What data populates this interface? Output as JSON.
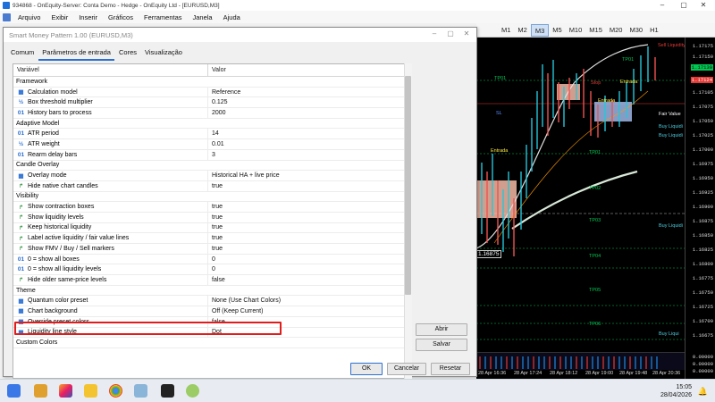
{
  "window": {
    "title": "934868 - OnEquity-Server: Conta Demo - Hedge - OnEquity Ltd - [EURUSD,M3]",
    "controls": [
      "–",
      "▢",
      "✕"
    ]
  },
  "menu": [
    "Arquivo",
    "Exibir",
    "Inserir",
    "Gráficos",
    "Ferramentas",
    "Janela",
    "Ajuda"
  ],
  "timeframes": [
    "M1",
    "M2",
    "M3",
    "M5",
    "M10",
    "M15",
    "M20",
    "M30",
    "H1"
  ],
  "active_timeframe": "M3",
  "chart": {
    "price_labels": [
      "1.17175",
      "1.17150",
      "1.17125",
      "1.17105",
      "1.17075",
      "1.17050",
      "1.17025",
      "1.17000",
      "1.16975",
      "1.16950",
      "1.16925",
      "1.16900",
      "1.16875",
      "1.16850",
      "1.16825",
      "1.16800",
      "1.16775",
      "1.16750",
      "1.16725",
      "1.16700",
      "1.16675",
      "1.16650",
      "1.16625",
      "1.16600"
    ],
    "price_current_green": "1.17139",
    "price_current_red": "1.17124",
    "time_labels": [
      "28 Apr 16:36",
      "28 Apr 17:24",
      "28 Apr 18:12",
      "28 Apr 19:00",
      "28 Apr 19:48",
      "28 Apr 20:36"
    ],
    "annotations": {
      "sell_liquidity": "Sell Liquidity",
      "fair_value": "Fair Value",
      "buy_liquidity_1": "Buy Liquidi",
      "buy_liquidity_2": "Buy Liquidi",
      "buy_liquidity_3": "Buy Liquidi",
      "entrada_1": "Entrada",
      "entrada_2": "Entrada",
      "entrada_3": "Entrada",
      "stop": "Stop",
      "tp1": "TP01",
      "tp1b": "TP01",
      "tp2": "TP02",
      "tp3": "TP03",
      "tp4": "TP04",
      "tp5": "TP05",
      "tp6": "TP06",
      "tp1c": "TP01",
      "sl": "SL",
      "price_box": "1.16875",
      "buy_liq_bottom": "Buy Liqui",
      "ind_values": [
        "0.00000",
        "0.00000",
        "0.00000"
      ]
    }
  },
  "dialog": {
    "title": "Smart Money Pattern 1.00 (EURUSD,M3)",
    "tabs": [
      "Comum",
      "Parâmetros de entrada",
      "Cores",
      "Visualização"
    ],
    "active_tab": "Parâmetros de entrada",
    "columns": [
      "Variável",
      "Valor"
    ],
    "rows": [
      {
        "type": "section",
        "label": "Framework"
      },
      {
        "icon": "enum",
        "label": "Calculation model",
        "value": "Reference"
      },
      {
        "icon": "frac",
        "label": "Box threshold multiplier",
        "value": "0.125"
      },
      {
        "icon": "int",
        "label": "History bars to process",
        "value": "2000"
      },
      {
        "type": "section",
        "label": "Adaptive Model"
      },
      {
        "icon": "int",
        "label": "ATR period",
        "value": "14"
      },
      {
        "icon": "frac",
        "label": "ATR weight",
        "value": "0.01"
      },
      {
        "icon": "int",
        "label": "Rearm delay bars",
        "value": "3"
      },
      {
        "type": "section",
        "label": "Candle Overlay"
      },
      {
        "icon": "enum",
        "label": "Overlay mode",
        "value": "Historical HA + live price"
      },
      {
        "icon": "bool",
        "label": "Hide native chart candles",
        "value": "true"
      },
      {
        "type": "section",
        "label": "Visibility"
      },
      {
        "icon": "bool",
        "label": "Show contraction boxes",
        "value": "true"
      },
      {
        "icon": "bool",
        "label": "Show liquidity levels",
        "value": "true"
      },
      {
        "icon": "bool",
        "label": "Keep historical liquidity",
        "value": "true"
      },
      {
        "icon": "bool",
        "label": "Label active liquidity / fair value lines",
        "value": "true"
      },
      {
        "icon": "bool",
        "label": "Show FMV / Buy / Sell markers",
        "value": "true"
      },
      {
        "icon": "int",
        "label": "0 = show all boxes",
        "value": "0"
      },
      {
        "icon": "int",
        "label": "0 = show all liquidity levels",
        "value": "0"
      },
      {
        "icon": "bool",
        "label": "Hide older same-price levels",
        "value": "false"
      },
      {
        "type": "section",
        "label": "Theme"
      },
      {
        "icon": "enum",
        "label": "Quantum color preset",
        "value": "None (Use Chart Colors)"
      },
      {
        "icon": "enum",
        "label": "Chart background",
        "value": "Off (Keep Current)"
      },
      {
        "icon": "enum",
        "label": "Override preset colors",
        "value": "false"
      },
      {
        "icon": "enum",
        "label": "Liquidity line style",
        "value": "Dot"
      },
      {
        "type": "section",
        "label": "Custom Colors"
      }
    ],
    "buttons": {
      "load": "Abrir",
      "save": "Salvar",
      "ok": "OK",
      "cancel": "Cancelar",
      "reset": "Resetar"
    }
  },
  "taskbar": {
    "time": "15:05",
    "date": "28/04/2026"
  }
}
